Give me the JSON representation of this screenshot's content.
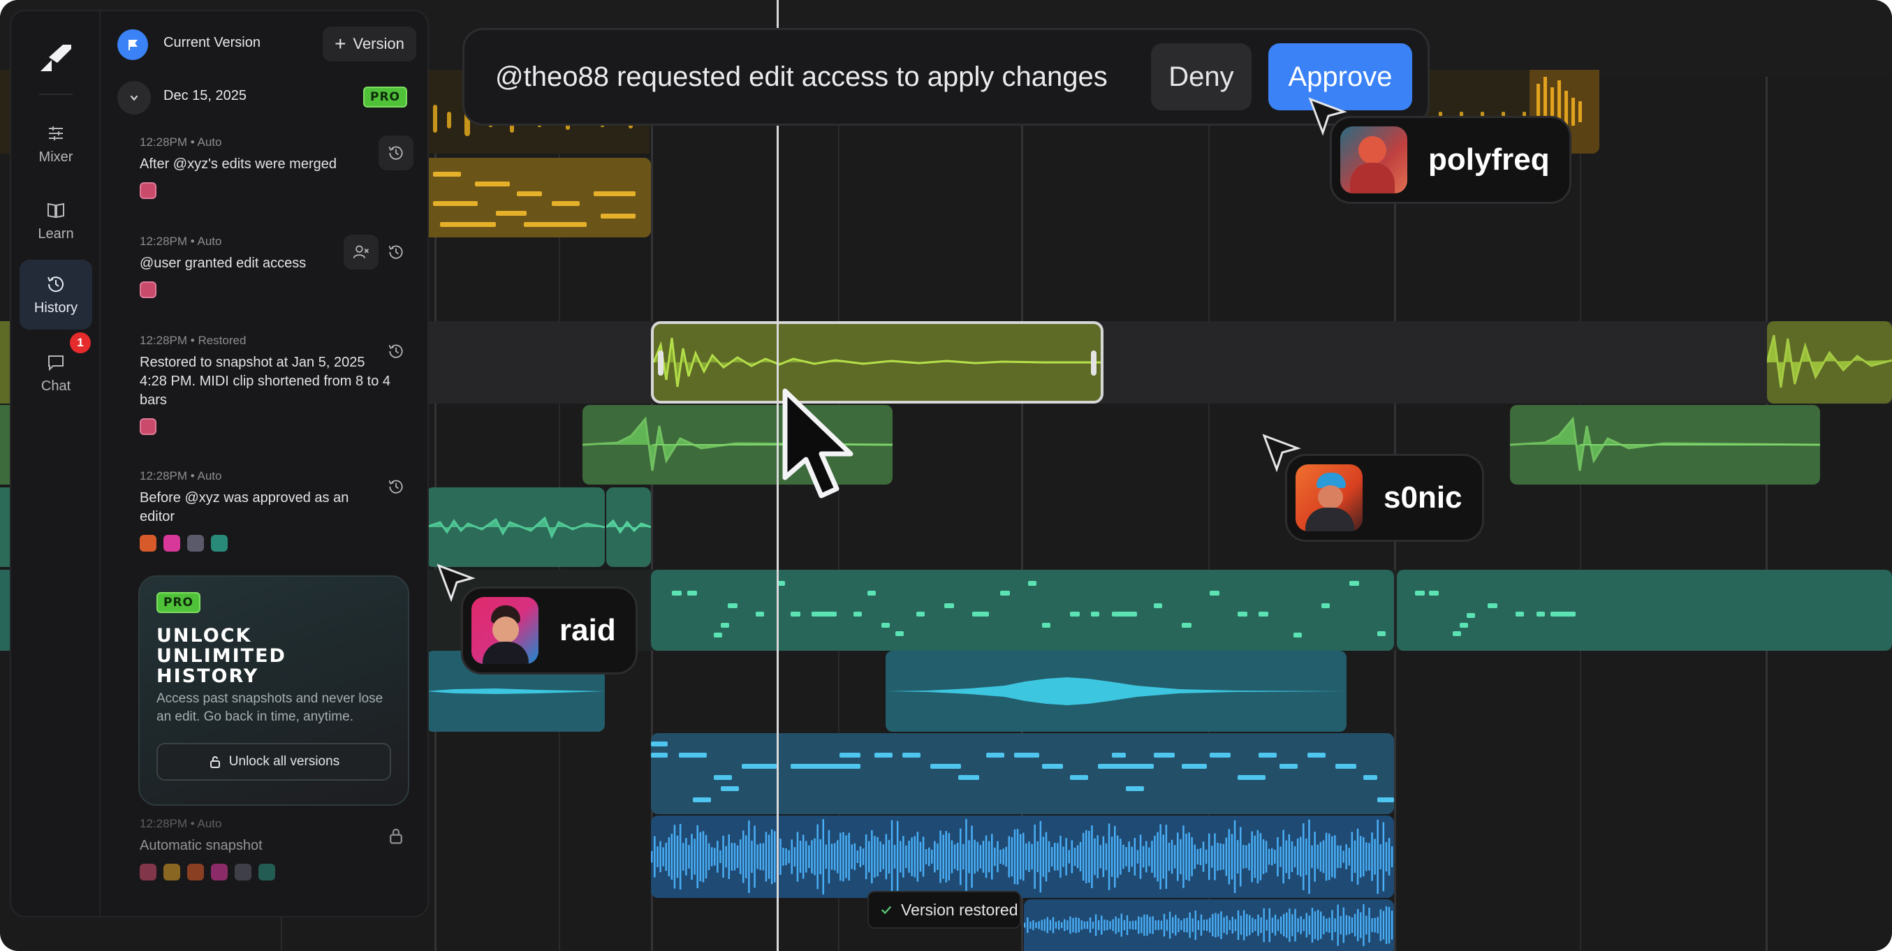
{
  "sidebar": {
    "rail": [
      {
        "label": "Mixer",
        "icon": "sliders-icon"
      },
      {
        "label": "Learn",
        "icon": "book-icon"
      },
      {
        "label": "History",
        "icon": "history-icon"
      },
      {
        "label": "Chat",
        "icon": "chat-icon"
      }
    ],
    "chat_badge": "1",
    "header": {
      "title": "Current Version",
      "add_version_label": "Version"
    },
    "date_group": {
      "date": "Dec 15, 2025",
      "badge": "PRO"
    },
    "entries": [
      {
        "meta": "12:28PM • Auto",
        "text": "After @xyz's edits were merged"
      },
      {
        "meta": "12:28PM • Auto",
        "text": "@user granted edit access"
      },
      {
        "meta": "12:28PM • Restored",
        "text": "Restored to snapshot at Jan 5, 2025 4:28 PM. MIDI clip shortened from 8 to 4 bars"
      },
      {
        "meta": "12:28PM • Auto",
        "text": "Before @xyz was approved as an editor"
      }
    ],
    "promo": {
      "badge": "PRO",
      "title_lines": [
        "UNLOCK",
        "UNLIMITED",
        "HISTORY"
      ],
      "body": "Access past snapshots and never lose an edit. Go back in time, anytime.",
      "button": "Unlock all versions"
    },
    "locked_entry": {
      "meta": "12:28PM • Auto",
      "text": "Automatic snapshot"
    }
  },
  "request": {
    "text": "@theo88 requested edit access to apply changes",
    "deny_label": "Deny",
    "approve_label": "Approve"
  },
  "collaborators": [
    {
      "name": "polyfreq"
    },
    {
      "name": "s0nic"
    },
    {
      "name": "raid"
    }
  ],
  "toast": {
    "text": "Version restored"
  },
  "colors": {
    "accent_blue": "#3b82f6",
    "pro_green": "#4fc23a",
    "notification_red": "#e52b2b",
    "track_yellow": "#c89a1e",
    "track_lime": "#9fd83a",
    "track_green": "#5fc45e",
    "track_teal": "#3fbf92",
    "track_cyan": "#3cc6e0",
    "track_blue": "#4aa8f0"
  }
}
